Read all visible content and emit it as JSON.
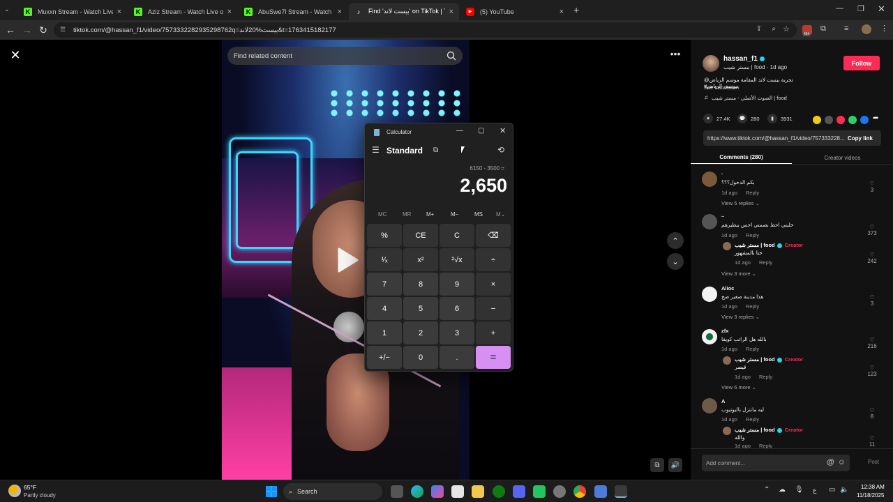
{
  "browser": {
    "tabs": [
      {
        "title": "Muxxn Stream - Watch Live on",
        "icon": "kick-icon",
        "color": "#53fc18"
      },
      {
        "title": "Aziz Stream - Watch Live on Ki",
        "icon": "kick-icon",
        "color": "#53fc18"
      },
      {
        "title": "AbuSwe7l Stream - Watch Live",
        "icon": "kick-icon",
        "color": "#53fc18"
      },
      {
        "title": "Find 'بيست لاند' on TikTok | TikTo",
        "icon": "tiktok-icon",
        "color": "#ffffff"
      },
      {
        "title": "(5) YouTube",
        "icon": "youtube-icon",
        "color": "#ff0000"
      }
    ],
    "url": "tiktok.com/@hassan_f1/video/7573332282935298762q=بيست%20لاند&t=1763415182177",
    "extension_badge": "454"
  },
  "video": {
    "search_placeholder": "Find related content"
  },
  "profile": {
    "username": "hassan_f1",
    "subtitle": "مستر شيب | food · 1d ago",
    "follow_label": "Follow",
    "caption": "تجربة بيست لاند المقامة موسم الرياض@ موسم_الرياض#",
    "see_translation": "See translation",
    "sound": "الصوت الأصلي - مستر شيب | food",
    "likes": "27.4K",
    "comments": "280",
    "saves": "3931",
    "link": "https://www.tiktok.com/@hassan_f1/video/757333228...",
    "copy_link": "Copy link",
    "tab_comments": "Comments (280)",
    "tab_creator": "Creator videos"
  },
  "comments": [
    {
      "name": ".",
      "text": "بكم الدخول؟؟؟",
      "time": "1d ago",
      "reply": "Reply",
      "likes": "3",
      "view_replies": "View 5 replies"
    },
    {
      "name": "..",
      "text": "خليني احط بصمتي احس بيطيرهم",
      "time": "1d ago",
      "reply": "Reply",
      "likes": "373",
      "sub": {
        "name": "مستر شيب | food",
        "badge": "Creator",
        "text": "حتا بالمشهور",
        "time": "1d ago",
        "reply": "Reply",
        "likes": "242"
      },
      "view_replies": "View 3 more"
    },
    {
      "name": "Alioc",
      "text": "هذا مدينة صغير صح",
      "time": "1d ago",
      "reply": "Reply",
      "likes": "3",
      "view_replies": "View 3 replies"
    },
    {
      "name": "zfx",
      "text": "بالله هل الراتب كويقا",
      "time": "1d ago",
      "reply": "Reply",
      "likes": "216",
      "sub": {
        "name": "مستر شيب | food",
        "badge": "Creator",
        "text": "قيصر",
        "time": "1d ago",
        "reply": "Reply",
        "likes": "123"
      },
      "view_replies": "View 6 more"
    },
    {
      "name": "A",
      "text": "ليه ماتنزل باليوتيوب",
      "time": "1d ago",
      "reply": "Reply",
      "likes": "8",
      "sub": {
        "name": "مستر شيب | food",
        "badge": "Creator",
        "text": "والله",
        "time": "1d ago",
        "reply": "Reply",
        "likes": "11"
      }
    }
  ],
  "comment_input": {
    "placeholder": "Add comment...",
    "post": "Post"
  },
  "calculator": {
    "title": "Calculator",
    "mode": "Standard",
    "expression": "6150 - 3500 =",
    "display": "2,650",
    "memory": [
      "MC",
      "MR",
      "M+",
      "M−",
      "MS",
      "M⌄"
    ],
    "keys": [
      "%",
      "CE",
      "C",
      "⌫",
      "¹⁄ₓ",
      "x²",
      "²√x",
      "÷",
      "7",
      "8",
      "9",
      "×",
      "4",
      "5",
      "6",
      "−",
      "1",
      "2",
      "3",
      "+",
      "+/−",
      "0",
      ".",
      "="
    ]
  },
  "taskbar": {
    "weather_temp": "65°F",
    "weather_desc": "Partly cloudy",
    "search": "Search",
    "time": "12:38 AM",
    "date": "11/18/2025"
  }
}
